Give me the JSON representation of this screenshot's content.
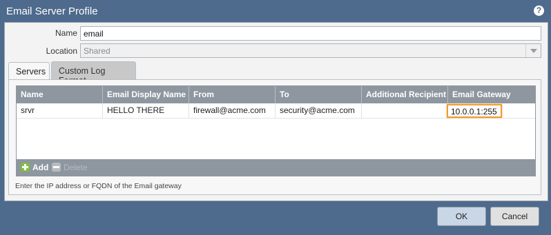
{
  "dialog": {
    "title": "Email Server Profile",
    "help_icon": "?"
  },
  "form": {
    "name_label": "Name",
    "name_value": "email",
    "location_label": "Location",
    "location_value": "Shared"
  },
  "tabs": [
    {
      "label": "Servers",
      "active": true
    },
    {
      "label": "Custom Log Format",
      "active": false
    }
  ],
  "servers_table": {
    "columns": [
      "Name",
      "Email Display Name",
      "From",
      "To",
      "Additional Recipient",
      "Email Gateway"
    ],
    "rows": [
      {
        "name": "srvr",
        "display_name": "HELLO THERE",
        "from": "firewall@acme.com",
        "to": "security@acme.com",
        "additional_recipient": "",
        "gateway": "10.0.0.1:255"
      }
    ],
    "add_label": "Add",
    "delete_label": "Delete"
  },
  "hint": "Enter the IP address or FQDN of the Email gateway",
  "buttons": {
    "ok": "OK",
    "cancel": "Cancel"
  },
  "colors": {
    "titlebar": "#4e6a8c",
    "table_header": "#8e969f",
    "focus_outline": "#f39a2e",
    "add_icon": "#7fbf3c"
  }
}
